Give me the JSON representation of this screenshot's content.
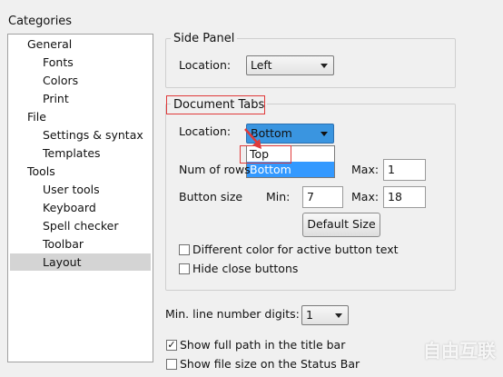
{
  "categories": {
    "title": "Categories",
    "items": [
      {
        "label": "General"
      },
      {
        "label": "Fonts"
      },
      {
        "label": "Colors"
      },
      {
        "label": "Print"
      },
      {
        "label": "File"
      },
      {
        "label": "Settings & syntax"
      },
      {
        "label": "Templates"
      },
      {
        "label": "Tools"
      },
      {
        "label": "User tools"
      },
      {
        "label": "Keyboard"
      },
      {
        "label": "Spell checker"
      },
      {
        "label": "Toolbar"
      },
      {
        "label": "Layout",
        "selected": true
      }
    ]
  },
  "side_panel": {
    "legend": "Side Panel",
    "location_label": "Location:",
    "location_value": "Left"
  },
  "document_tabs": {
    "legend": "Document Tabs",
    "location_label": "Location:",
    "location_value": "Bottom",
    "dropdown_options": [
      "Top",
      "Bottom"
    ],
    "dropdown_selected": "Bottom",
    "num_rows_label": "Num of rows",
    "max_label": "Max:",
    "num_rows_max": "1",
    "button_size_label": "Button size",
    "min_label": "Min:",
    "button_min": "7",
    "button_max": "18",
    "default_size_button": "Default Size",
    "diff_color_label": "Different color for active button text",
    "diff_color_checked": false,
    "hide_close_label": "Hide close buttons",
    "hide_close_checked": false
  },
  "min_line_digits": {
    "label": "Min. line number digits:",
    "value": "1"
  },
  "show_full_path": {
    "label": "Show full path in the title bar",
    "checked": true
  },
  "show_file_size": {
    "label": "Show file size on the Status Bar",
    "checked": false
  },
  "watermark": "自由互联",
  "colors": {
    "annotation_red": "#e03a3a",
    "selection_blue": "#3399ff"
  }
}
